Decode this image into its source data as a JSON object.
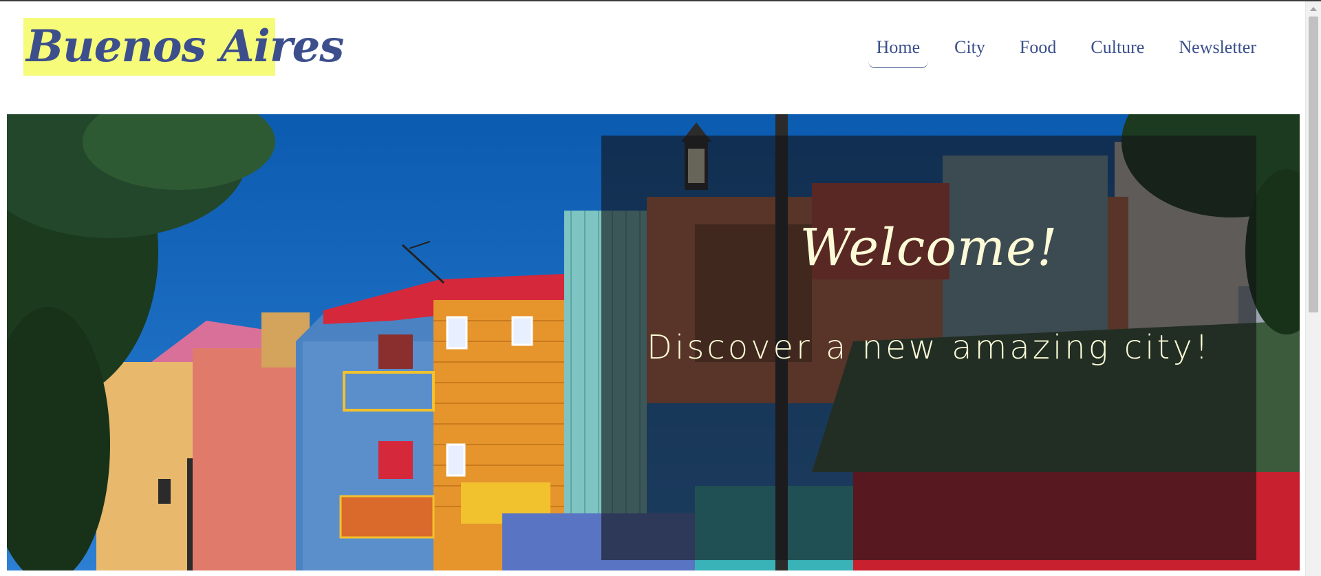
{
  "site": {
    "logo_text": "Buenos Aires"
  },
  "nav": {
    "items": [
      {
        "label": "Home",
        "active": true
      },
      {
        "label": "City",
        "active": false
      },
      {
        "label": "Food",
        "active": false
      },
      {
        "label": "Culture",
        "active": false
      },
      {
        "label": "Newsletter",
        "active": false
      }
    ]
  },
  "hero": {
    "title": "Welcome!",
    "subtitle": "Discover a new amazing city!",
    "image_icon": "la-boca-colorful-houses-photo"
  },
  "colors": {
    "logo_bg": "#f6fb7a",
    "brand_blue": "#3c4f8c",
    "hero_text": "#fdfbd7"
  }
}
